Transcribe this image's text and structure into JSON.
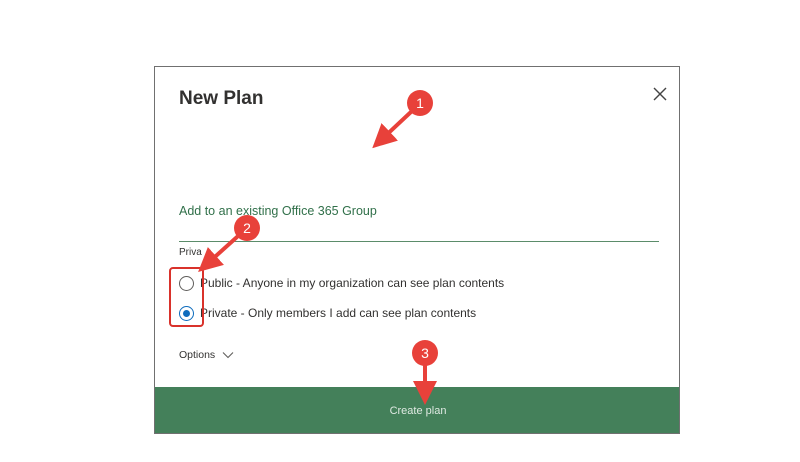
{
  "dialog": {
    "title": "New Plan",
    "name_input": {
      "value": "",
      "placeholder": ""
    },
    "group_link": "Add to an existing Office 365 Group",
    "privacy_label": "Privacy",
    "privacy_label_visible": "Priva",
    "privacy_options": [
      {
        "label": "Public - Anyone in my organization can see plan contents",
        "selected": false
      },
      {
        "label": "Private - Only members I add can see plan contents",
        "selected": true
      }
    ],
    "options_label": "Options",
    "create_button_label": "Create plan"
  },
  "annotations": {
    "markers": [
      "1",
      "2",
      "3"
    ],
    "marker_color": "#e8413a",
    "highlight_color": "#d9322b"
  },
  "colors": {
    "accent_green": "#44805a",
    "link_green": "#31704a",
    "radio_blue": "#0f6cbd"
  },
  "icons": {
    "close": "close-icon",
    "options_toggle": "chevron-down-icon"
  }
}
